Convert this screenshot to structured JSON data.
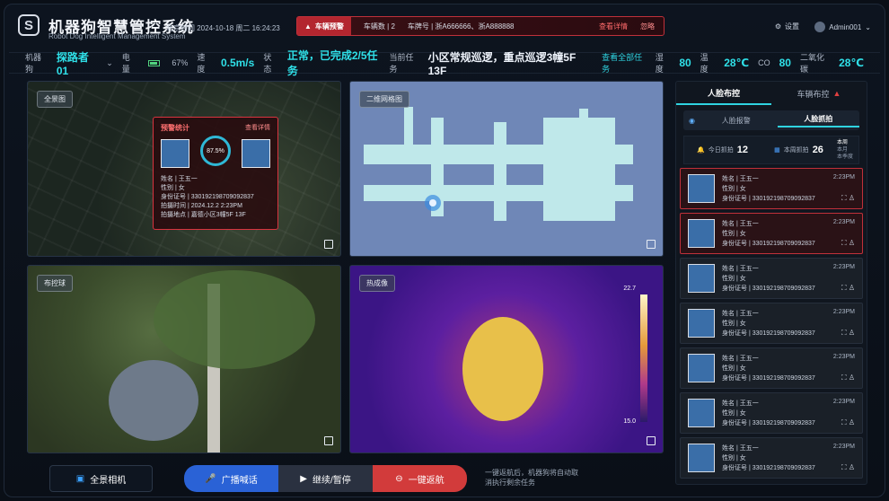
{
  "header": {
    "logo_glyph": "S",
    "title_cn": "机器狗智慧管控系统",
    "title_en": "Robot Dog Intelligent Management System",
    "datetime": "北京时间  2024-10-18 周二 16:24:23",
    "alert": {
      "tag": "车辆预警",
      "count": "车辆数 | 2",
      "plates": "车牌号 | 浙A666666、浙A888888",
      "detail_link": "查看详情",
      "ignore": "忽略"
    },
    "settings_label": "设置",
    "user_name": "Admin001"
  },
  "status": {
    "robot_label": "机器狗",
    "robot_value": "探路者01",
    "battery_label": "电量",
    "battery_value": "67%",
    "speed_label": "速度",
    "speed_value": "0.5m/s",
    "state_label": "状态",
    "state_value": "正常，已完成2/5任务",
    "task_label": "当前任务",
    "task_value": "小区常规巡逻，重点巡逻3幢5F 13F",
    "view_all_tasks": "查看全部任务",
    "humidity_label": "湿度",
    "humidity_value": "80",
    "temp_label": "温度",
    "temp_value": "28℃",
    "co_label": "CO",
    "co_value": "80",
    "co2_label": "二氧化碳",
    "co2_value": "28℃"
  },
  "panels": {
    "map_tag": "全景图",
    "grid_tag": "二维网格图",
    "camera_tag": "布控球",
    "thermal_tag": "热成像",
    "thermal_max": "22.7",
    "thermal_min": "15.0"
  },
  "popup": {
    "title": "预警统计",
    "detail": "查看详情",
    "similarity": "87.5%",
    "name": "姓名 | 王五一",
    "gender": "性别 | 女",
    "id": "身份证号 | 330192198709092837",
    "time": "拍摄时间 | 2024.12.2  2:23PM",
    "place": "拍摄地点 | 嘉德小区3幢5F 13F"
  },
  "side": {
    "tab_face": "人脸布控",
    "tab_vehicle": "车辆布控",
    "sub_alert": "人脸报警",
    "sub_capture": "人脸抓拍",
    "today_label": "今日抓拍",
    "today_value": "12",
    "week_label": "本周抓拍",
    "week_value": "26",
    "period_week": "本周",
    "period_month": "本月",
    "period_quarter": "本季度",
    "cards": [
      {
        "name": "姓名 | 王五一",
        "gender": "性别 | 女",
        "id": "身份证号 | 330192198709092837",
        "time": "2:23PM"
      },
      {
        "name": "姓名 | 王五一",
        "gender": "性别 | 女",
        "id": "身份证号 | 330192198709092837",
        "time": "2:23PM"
      },
      {
        "name": "姓名 | 王五一",
        "gender": "性别 | 女",
        "id": "身份证号 | 330192198709092837",
        "time": "2:23PM"
      },
      {
        "name": "姓名 | 王五一",
        "gender": "性别 | 女",
        "id": "身份证号 | 330192198709092837",
        "time": "2:23PM"
      },
      {
        "name": "姓名 | 王五一",
        "gender": "性别 | 女",
        "id": "身份证号 | 330192198709092837",
        "time": "2:23PM"
      },
      {
        "name": "姓名 | 王五一",
        "gender": "性别 | 女",
        "id": "身份证号 | 330192198709092837",
        "time": "2:23PM"
      },
      {
        "name": "姓名 | 王五一",
        "gender": "性别 | 女",
        "id": "身份证号 | 330192198709092837",
        "time": "2:23PM"
      }
    ]
  },
  "bottom": {
    "panorama": "全景相机",
    "broadcast": "广播喊话",
    "pause": "继续/暂停",
    "return": "一键返航",
    "note": "一键返航后，机器狗将自动取消执行剩余任务"
  }
}
